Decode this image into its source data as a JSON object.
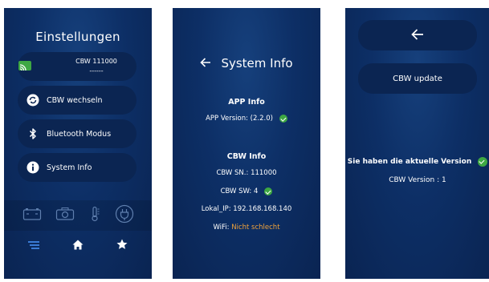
{
  "settings": {
    "title": "Einstellungen",
    "cbw_device": {
      "serial": "CBW 111000",
      "sub": "------",
      "icon": "cast-icon"
    },
    "menu": [
      {
        "label": "CBW wechseln",
        "icon": "swap-icon"
      },
      {
        "label": "Bluetooth Modus",
        "icon": "bluetooth-icon"
      },
      {
        "label": "System Info",
        "icon": "info-icon"
      }
    ],
    "status_icons": [
      "battery-icon",
      "camera-icon",
      "thermometer-icon",
      "power-plug-icon"
    ],
    "nav": [
      "menu-icon",
      "home-icon",
      "star-icon"
    ]
  },
  "system_info": {
    "title": "System Info",
    "app_section": "APP Info",
    "app_version_label": "APP Version:",
    "app_version": "(2.2.0)",
    "cbw_section": "CBW Info",
    "cbw_sn_label": "CBW SN.:",
    "cbw_sn": "111000",
    "cbw_sw_label": "CBW SW:",
    "cbw_sw": "4",
    "lokal_ip_label": "Lokal_IP:",
    "lokal_ip": "192.168.168.140",
    "wifi_label": "WiFi:",
    "wifi_value": "Nicht schlecht"
  },
  "update": {
    "button_label": "CBW update",
    "status": "Sie haben die aktuelle Version",
    "version_label": "CBW Version :",
    "version": "1"
  },
  "colors": {
    "accent_green": "#3ea843",
    "warning_orange": "#f0a23a",
    "panel_bg": "#0d2f66",
    "pill_bg": "#0b2552"
  }
}
